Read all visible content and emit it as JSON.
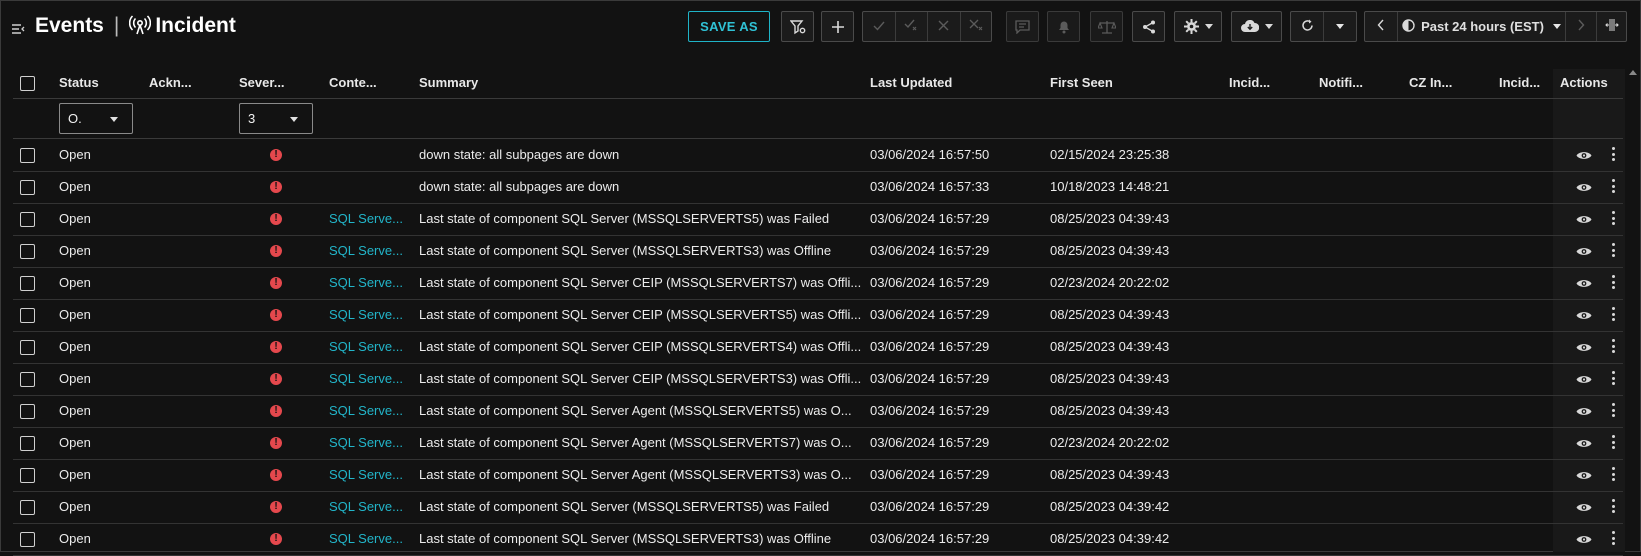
{
  "header": {
    "title": "Events",
    "subtitle": "Incident",
    "save_as_label": "SAVE AS",
    "time_range": "Past 24 hours (EST)",
    "icons": [
      "collapse-icon",
      "broadcast-icon",
      "filter-gear-icon",
      "plus-icon",
      "check-icon",
      "check-x-icon",
      "close-icon",
      "close-x-icon",
      "comment-icon",
      "bell-icon",
      "scale-icon",
      "share-icon",
      "gear-icon",
      "cloud-download-icon",
      "refresh-icon",
      "chevron-left-icon",
      "clock-icon",
      "chevron-right-icon",
      "columns-icon"
    ]
  },
  "table": {
    "columns": [
      "Status",
      "Ackn...",
      "Sever...",
      "Conte...",
      "Summary",
      "Last Updated",
      "First Seen",
      "Incid...",
      "Notifi...",
      "CZ In...",
      "Incid...",
      "Actions"
    ],
    "filters": {
      "status_value": "O.",
      "severity_value": "3"
    },
    "rows": [
      {
        "status": "Open",
        "context": "",
        "summary": "down state: all subpages are down",
        "last_updated": "03/06/2024 16:57:50",
        "first_seen": "02/15/2024 23:25:38"
      },
      {
        "status": "Open",
        "context": "",
        "summary": "down state: all subpages are down",
        "last_updated": "03/06/2024 16:57:33",
        "first_seen": "10/18/2023 14:48:21"
      },
      {
        "status": "Open",
        "context": "SQL Serve...",
        "summary": "Last state of component SQL Server (MSSQLSERVERTS5) was Failed",
        "last_updated": "03/06/2024 16:57:29",
        "first_seen": "08/25/2023 04:39:43"
      },
      {
        "status": "Open",
        "context": "SQL Serve...",
        "summary": "Last state of component SQL Server (MSSQLSERVERTS3) was Offline",
        "last_updated": "03/06/2024 16:57:29",
        "first_seen": "08/25/2023 04:39:43"
      },
      {
        "status": "Open",
        "context": "SQL Serve...",
        "summary": "Last state of component SQL Server CEIP (MSSQLSERVERTS7) was Offli...",
        "last_updated": "03/06/2024 16:57:29",
        "first_seen": "02/23/2024 20:22:02"
      },
      {
        "status": "Open",
        "context": "SQL Serve...",
        "summary": "Last state of component SQL Server CEIP (MSSQLSERVERTS5) was Offli...",
        "last_updated": "03/06/2024 16:57:29",
        "first_seen": "08/25/2023 04:39:43"
      },
      {
        "status": "Open",
        "context": "SQL Serve...",
        "summary": "Last state of component SQL Server CEIP (MSSQLSERVERTS4) was Offli...",
        "last_updated": "03/06/2024 16:57:29",
        "first_seen": "08/25/2023 04:39:43"
      },
      {
        "status": "Open",
        "context": "SQL Serve...",
        "summary": "Last state of component SQL Server CEIP (MSSQLSERVERTS3) was Offli...",
        "last_updated": "03/06/2024 16:57:29",
        "first_seen": "08/25/2023 04:39:43"
      },
      {
        "status": "Open",
        "context": "SQL Serve...",
        "summary": "Last state of component SQL Server Agent (MSSQLSERVERTS5) was O...",
        "last_updated": "03/06/2024 16:57:29",
        "first_seen": "08/25/2023 04:39:43"
      },
      {
        "status": "Open",
        "context": "SQL Serve...",
        "summary": "Last state of component SQL Server Agent (MSSQLSERVERTS7) was O...",
        "last_updated": "03/06/2024 16:57:29",
        "first_seen": "02/23/2024 20:22:02"
      },
      {
        "status": "Open",
        "context": "SQL Serve...",
        "summary": "Last state of component SQL Server Agent (MSSQLSERVERTS3) was O...",
        "last_updated": "03/06/2024 16:57:29",
        "first_seen": "08/25/2023 04:39:43"
      },
      {
        "status": "Open",
        "context": "SQL Serve...",
        "summary": "Last state of component SQL Server (MSSQLSERVERTS5) was Failed",
        "last_updated": "03/06/2024 16:57:29",
        "first_seen": "08/25/2023 04:39:42"
      },
      {
        "status": "Open",
        "context": "SQL Serve...",
        "summary": "Last state of component SQL Server (MSSQLSERVERTS3) was Offline",
        "last_updated": "03/06/2024 16:57:29",
        "first_seen": "08/25/2023 04:39:42"
      }
    ]
  },
  "colors": {
    "accent": "#22b5c9",
    "severity_critical": "#e5484d",
    "background": "#121212"
  }
}
